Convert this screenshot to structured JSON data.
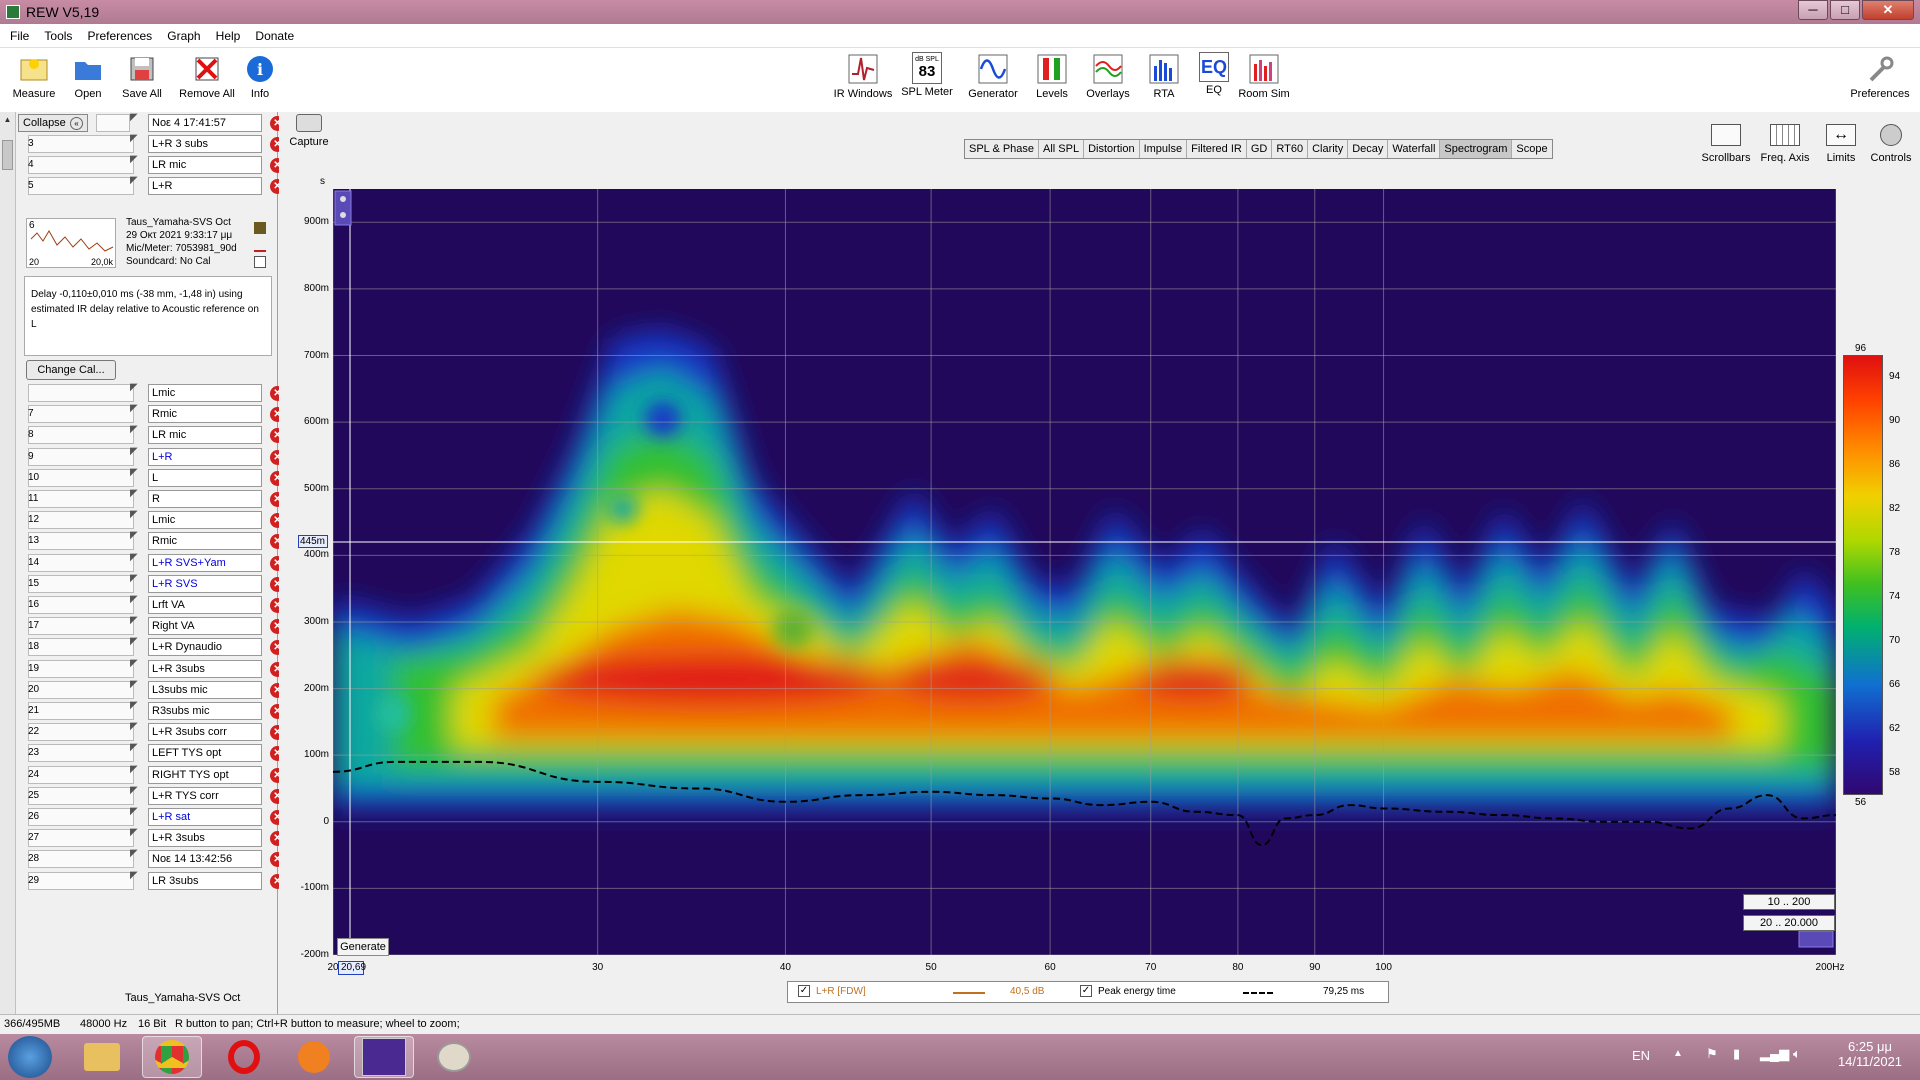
{
  "window": {
    "title": "REW V5,19",
    "min": "─",
    "max": "□",
    "close": "✕"
  },
  "menu": [
    "File",
    "Tools",
    "Preferences",
    "Graph",
    "Help",
    "Donate"
  ],
  "toolbar_left": [
    {
      "label": "Measure",
      "icon": "measure-icon"
    },
    {
      "label": "Open",
      "icon": "open-folder-icon"
    },
    {
      "label": "Save All",
      "icon": "save-icon"
    },
    {
      "label": "Remove All",
      "icon": "remove-icon"
    },
    {
      "label": "Info",
      "icon": "info-icon"
    }
  ],
  "toolbar_center": [
    {
      "label": "IR Windows",
      "icon": "ir-windows-icon"
    },
    {
      "label": "SPL Meter",
      "icon": "spl-meter-icon",
      "badge_top": "dB SPL",
      "badge_value": "83"
    },
    {
      "label": "Generator",
      "icon": "generator-icon"
    },
    {
      "label": "Levels",
      "icon": "levels-icon"
    },
    {
      "label": "Overlays",
      "icon": "overlays-icon"
    },
    {
      "label": "RTA",
      "icon": "rta-icon"
    },
    {
      "label": "EQ",
      "icon": "eq-icon"
    },
    {
      "label": "Room Sim",
      "icon": "room-sim-icon"
    }
  ],
  "preferences_label": "Preferences",
  "panel": {
    "collapse_label": "Collapse",
    "top_items": [
      {
        "num": "",
        "name": "Noε 4 17:41:57",
        "blue": false
      },
      {
        "num": "3",
        "name": "L+R 3 subs",
        "blue": false
      },
      {
        "num": "4",
        "name": "LR mic",
        "blue": false
      },
      {
        "num": "5",
        "name": "L+R",
        "blue": false
      }
    ],
    "selected": {
      "num": "6",
      "lines": [
        "Taus_Yamaha-SVS Oct",
        "29 Οκτ 2021 9:33:17 μμ",
        "Mic/Meter: 7053981_90d",
        "Soundcard: No Cal"
      ],
      "range_lo": "20",
      "range_hi": "20,0k"
    },
    "delay_note": "Delay -0,110±0,010 ms (-38 mm, -1,48 in) using estimated IR delay relative to Acoustic reference on  L",
    "change_cal": "Change Cal...",
    "items": [
      {
        "num": "",
        "name": "Lmic",
        "blue": false
      },
      {
        "num": "7",
        "name": "Rmic",
        "blue": false
      },
      {
        "num": "8",
        "name": "LR mic",
        "blue": false
      },
      {
        "num": "9",
        "name": "L+R",
        "blue": true
      },
      {
        "num": "10",
        "name": "L",
        "blue": false
      },
      {
        "num": "11",
        "name": "R",
        "blue": false
      },
      {
        "num": "12",
        "name": "Lmic",
        "blue": false
      },
      {
        "num": "13",
        "name": "Rmic",
        "blue": false
      },
      {
        "num": "14",
        "name": "L+R SVS+Yam",
        "blue": true
      },
      {
        "num": "15",
        "name": "L+R SVS",
        "blue": true
      },
      {
        "num": "16",
        "name": "Lrft VA",
        "blue": false
      },
      {
        "num": "17",
        "name": "Right VA",
        "blue": false
      },
      {
        "num": "18",
        "name": "L+R Dynaudio",
        "blue": false
      },
      {
        "num": "19",
        "name": "L+R 3subs",
        "blue": false
      },
      {
        "num": "20",
        "name": "L3subs mic",
        "blue": false
      },
      {
        "num": "21",
        "name": "R3subs mic",
        "blue": false
      },
      {
        "num": "22",
        "name": "L+R 3subs corr",
        "blue": false
      },
      {
        "num": "23",
        "name": "LEFT TYS opt",
        "blue": false
      },
      {
        "num": "24",
        "name": "RIGHT TYS opt",
        "blue": false
      },
      {
        "num": "25",
        "name": "L+R TYS corr",
        "blue": false
      },
      {
        "num": "26",
        "name": "L+R sat",
        "blue": true
      },
      {
        "num": "27",
        "name": "L+R 3subs",
        "blue": false
      },
      {
        "num": "28",
        "name": "Noε 14 13:42:56",
        "blue": false
      },
      {
        "num": "29",
        "name": "LR 3subs",
        "blue": false
      }
    ],
    "bottom_partial": "Taus_Yamaha-SVS Oct"
  },
  "graph": {
    "capture_label": "Capture",
    "tabs": [
      "SPL & Phase",
      "All SPL",
      "Distortion",
      "Impulse",
      "Filtered IR",
      "GD",
      "RT60",
      "Clarity",
      "Decay",
      "Waterfall",
      "Spectrogram",
      "Scope"
    ],
    "active_tab": "Spectrogram",
    "right_tools": [
      "Scrollbars",
      "Freq. Axis",
      "Limits",
      "Controls"
    ],
    "y_unit": "s",
    "cursor_x": "20,69",
    "cursor_y": "445m",
    "generate": "Generate",
    "range_buttons": [
      "10 .. 200",
      "20 .. 20.000"
    ],
    "colorbar_labels": [
      "96",
      "94",
      "90",
      "86",
      "82",
      "78",
      "74",
      "70",
      "66",
      "62",
      "58",
      "56"
    ],
    "legend": {
      "series": "L+R [FDW]",
      "series_value": "40,5 dB",
      "peak_label": "Peak energy time",
      "peak_value": "79,25 ms"
    }
  },
  "chart_data": {
    "type": "heatmap",
    "xlabel": "Hz",
    "ylabel": "s",
    "x_scale": "log",
    "xlim": [
      20,
      200
    ],
    "ylim": [
      -0.2,
      0.95
    ],
    "x_ticks": [
      "20",
      "30",
      "40",
      "50",
      "60",
      "70",
      "80",
      "90",
      "100",
      "200Hz"
    ],
    "y_ticks": [
      "900m",
      "800m",
      "700m",
      "600m",
      "500m",
      "400m",
      "300m",
      "200m",
      "100m",
      "0",
      "-100m",
      "-200m"
    ],
    "colorscale_db": [
      56,
      96
    ],
    "peak_energy_time_ms": [
      [
        20,
        75
      ],
      [
        22,
        90
      ],
      [
        25,
        90
      ],
      [
        30,
        60
      ],
      [
        35,
        50
      ],
      [
        40,
        30
      ],
      [
        45,
        40
      ],
      [
        50,
        45
      ],
      [
        55,
        40
      ],
      [
        60,
        35
      ],
      [
        65,
        25
      ],
      [
        70,
        30
      ],
      [
        75,
        15
      ],
      [
        80,
        10
      ],
      [
        83,
        -35
      ],
      [
        86,
        5
      ],
      [
        90,
        10
      ],
      [
        95,
        25
      ],
      [
        100,
        20
      ],
      [
        110,
        15
      ],
      [
        120,
        10
      ],
      [
        130,
        5
      ],
      [
        140,
        0
      ],
      [
        150,
        0
      ],
      [
        160,
        -10
      ],
      [
        170,
        20
      ],
      [
        180,
        40
      ],
      [
        190,
        5
      ],
      [
        200,
        10
      ]
    ]
  },
  "status": {
    "memory": "366/495MB",
    "rate": "48000 Hz",
    "bits": "16 Bit",
    "hint": "R button to pan; Ctrl+R button to measure; wheel to zoom;"
  },
  "taskbar": {
    "lang": "EN",
    "time": "6:25 μμ",
    "date": "14/11/2021"
  }
}
